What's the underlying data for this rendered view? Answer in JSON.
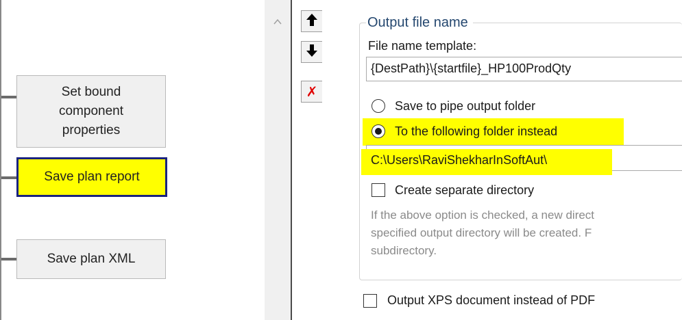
{
  "plan_nodes": [
    {
      "label": "Set bound component properties"
    },
    {
      "label": "Save plan report"
    },
    {
      "label": "Save plan XML"
    }
  ],
  "toolbar": {
    "move_up_icon": "arrow-up-icon",
    "move_down_icon": "arrow-down-icon",
    "delete_icon": "red-x-icon",
    "delete_glyph": "✗"
  },
  "output_file_name": {
    "legend": "Output file name",
    "template_label": "File name template:",
    "template_value": "{DestPath}\\{startfile}_HP100ProdQty",
    "option_pipe_folder": "Save to pipe output folder",
    "option_following_folder": "To the following folder instead",
    "selected_option": "following_folder",
    "folder_path": "C:\\Users\\RaviShekharInSoftAut\\",
    "create_separate_directory_label": "Create separate directory",
    "create_separate_directory_checked": false,
    "help_lines": [
      "If the above option is checked, a new direct",
      "specified output directory will be created. F",
      "subdirectory."
    ]
  },
  "output_xps_label": "Output XPS document instead of PDF",
  "output_xps_checked": false,
  "colors": {
    "highlight": "#ffff00",
    "selected_border": "#1a237e",
    "legend_text": "#24476f",
    "delete_red": "#e00000"
  }
}
